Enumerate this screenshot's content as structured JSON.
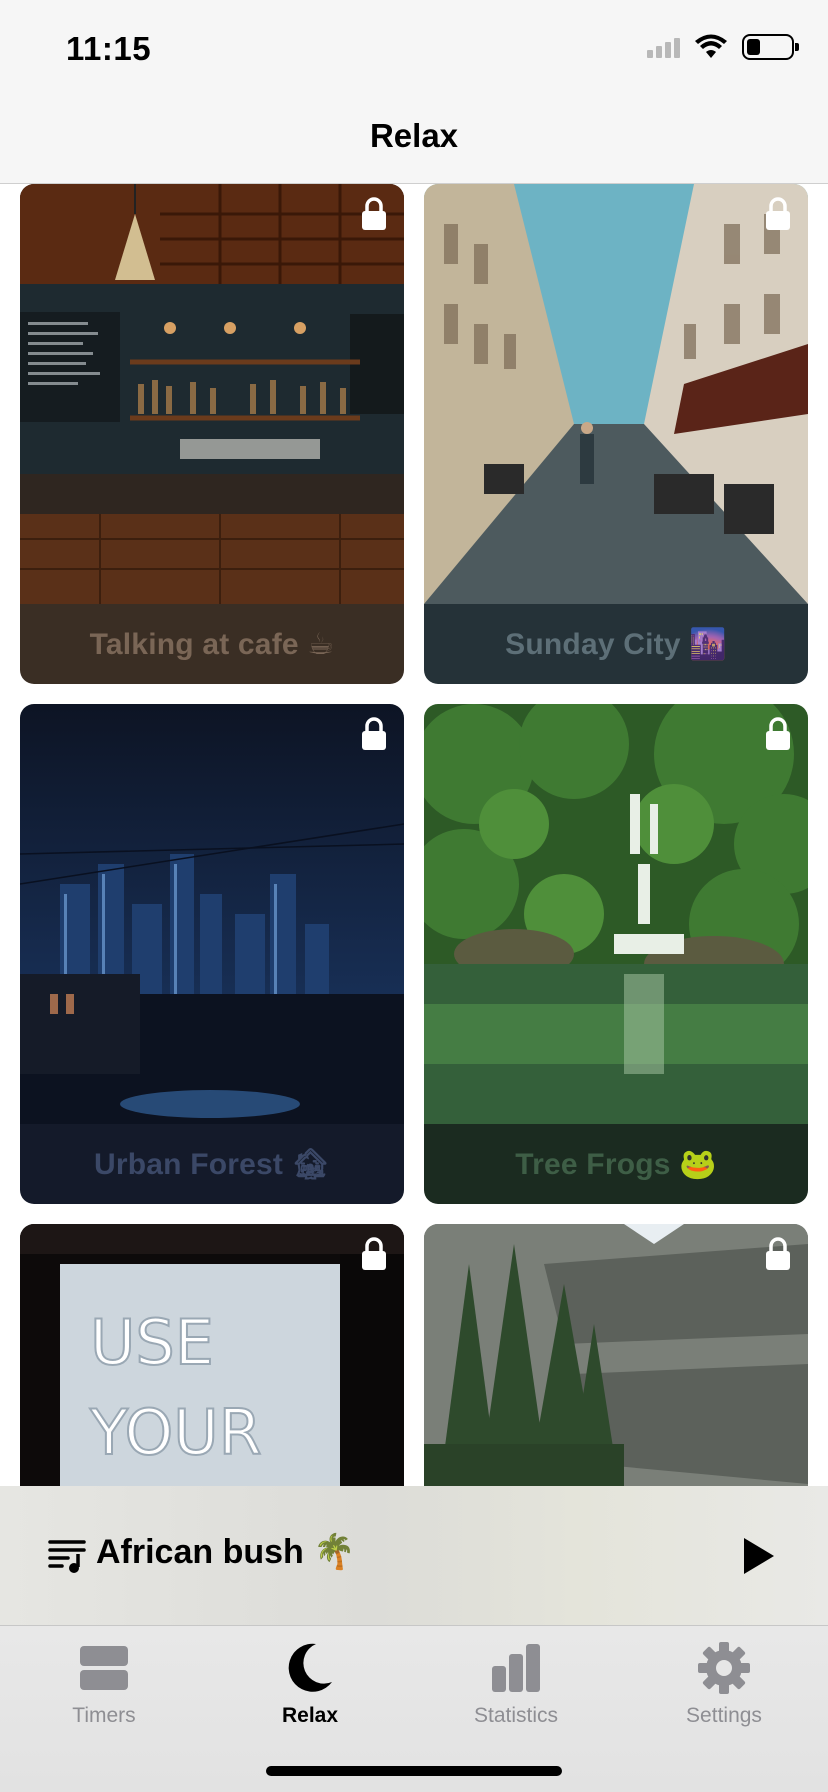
{
  "status_bar": {
    "time": "11:15",
    "battery_level": 0.3
  },
  "nav": {
    "title": "Relax"
  },
  "cards": [
    {
      "title": "Talking at cafe ☕",
      "locked": true,
      "footer_color": "#3a2e24",
      "text_color": "#7a6656"
    },
    {
      "title": "Sunday City 🌆",
      "locked": true,
      "footer_color": "#253238",
      "text_color": "#5d6f77"
    },
    {
      "title": "Urban Forest 🏚",
      "locked": true,
      "footer_color": "#141a2a",
      "text_color": "#3b4867"
    },
    {
      "title": "Tree Frogs 🐸",
      "locked": true,
      "footer_color": "#1b2b20",
      "text_color": "#3e5e46"
    },
    {
      "title": "",
      "locked": true,
      "footer_color": "#111111",
      "text_color": "#555555"
    },
    {
      "title": "",
      "locked": true,
      "footer_color": "#2a2f2a",
      "text_color": "#5a5f5a"
    }
  ],
  "player": {
    "now_playing": "African bush 🌴",
    "queue_icon": "queue-music-icon",
    "play_icon": "play-icon"
  },
  "tabs": [
    {
      "label": "Timers",
      "icon": "stack-icon",
      "active": false
    },
    {
      "label": "Relax",
      "icon": "moon-icon",
      "active": true
    },
    {
      "label": "Statistics",
      "icon": "bar-chart-icon",
      "active": false
    },
    {
      "label": "Settings",
      "icon": "gear-icon",
      "active": false
    }
  ],
  "neon_sign": "USE YOUR"
}
